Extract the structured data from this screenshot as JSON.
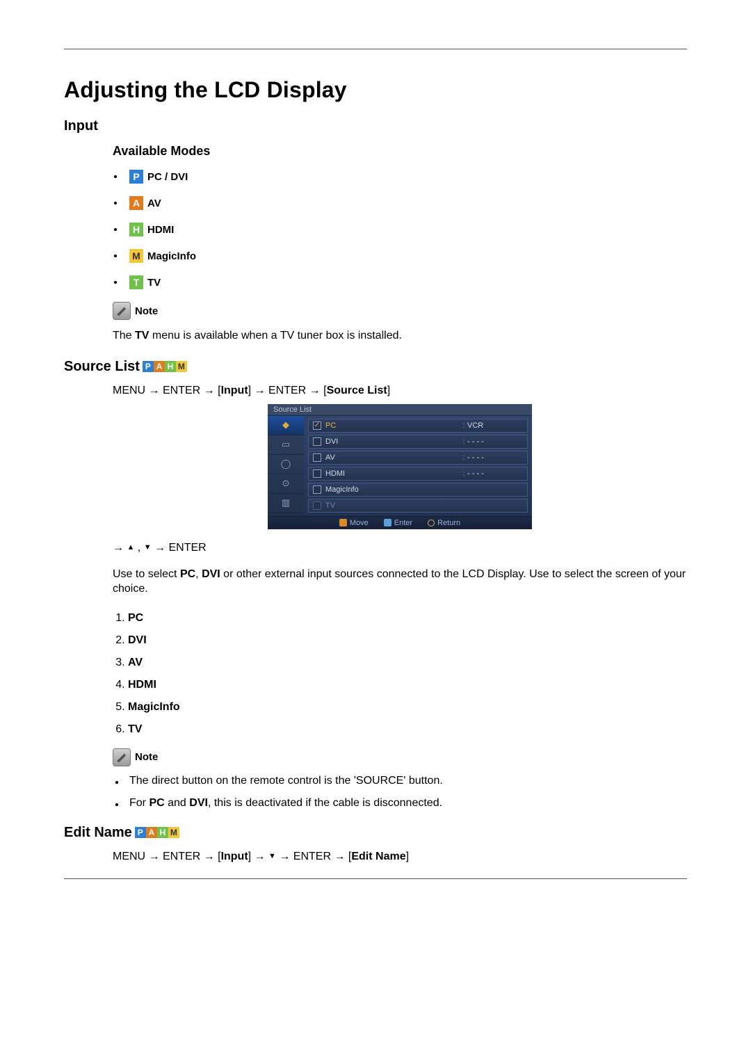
{
  "title": "Adjusting the LCD Display",
  "sections": {
    "input": {
      "heading": "Input",
      "available_modes_heading": "Available Modes",
      "modes": [
        {
          "icon_letter": "P",
          "icon_class": "icon-p",
          "icon_name": "p-icon",
          "label": "PC / DVI"
        },
        {
          "icon_letter": "A",
          "icon_class": "icon-a",
          "icon_name": "a-icon",
          "label": "AV"
        },
        {
          "icon_letter": "H",
          "icon_class": "icon-h",
          "icon_name": "h-icon",
          "label": "HDMI"
        },
        {
          "icon_letter": "M",
          "icon_class": "icon-m",
          "icon_name": "m-icon",
          "label": "MagicInfo"
        },
        {
          "icon_letter": "T",
          "icon_class": "icon-t",
          "icon_name": "t-icon",
          "label": "TV"
        }
      ],
      "note_label": "Note",
      "note_text_pre": "The ",
      "note_text_bold": "TV",
      "note_text_post": " menu is available when a TV tuner box is installed."
    },
    "source_list": {
      "heading": "Source List",
      "path_pre": "MENU → ENTER → [",
      "path_b1": "Input",
      "path_mid": "] → ENTER → [",
      "path_b2": "Source List",
      "path_post": "]",
      "osd": {
        "title": "Source List",
        "rows": [
          {
            "name": "PC",
            "val": "VCR",
            "active": true,
            "checked": true
          },
          {
            "name": "DVI",
            "val": "- - - -",
            "active": false,
            "checked": false
          },
          {
            "name": "AV",
            "val": "- - - -",
            "active": false,
            "checked": false
          },
          {
            "name": "HDMI",
            "val": "- - - -",
            "active": false,
            "checked": false
          },
          {
            "name": "MagicInfo",
            "val": "",
            "active": false,
            "checked": false
          },
          {
            "name": "TV",
            "val": "",
            "active": false,
            "checked": false,
            "dim": true
          }
        ],
        "footer": {
          "move": "Move",
          "enter": "Enter",
          "return": "Return"
        }
      },
      "arrow_line_pre": "→ ",
      "arrow_line_post": " → ENTER",
      "desc_pre": "Use to select ",
      "desc_b1": "PC",
      "desc_mid1": ", ",
      "desc_b2": "DVI",
      "desc_post": " or other external input sources connected to the LCD Display. Use to select the screen of your choice.",
      "sources_list": [
        "PC",
        "DVI",
        "AV",
        "HDMI",
        "MagicInfo",
        "TV"
      ],
      "note2_label": "Note",
      "bullets": {
        "b1": "The direct button on the remote control is the 'SOURCE' button.",
        "b2_pre": "For ",
        "b2_b1": "PC",
        "b2_mid": " and ",
        "b2_b2": "DVI",
        "b2_post": ", this is deactivated if the cable is disconnected."
      }
    },
    "edit_name": {
      "heading": "Edit Name",
      "path_pre": "MENU → ENTER → [",
      "path_b1": "Input",
      "path_mid1": "] → ",
      "path_mid2": " → ENTER → [",
      "path_b2": "Edit Name",
      "path_post": "]"
    }
  }
}
